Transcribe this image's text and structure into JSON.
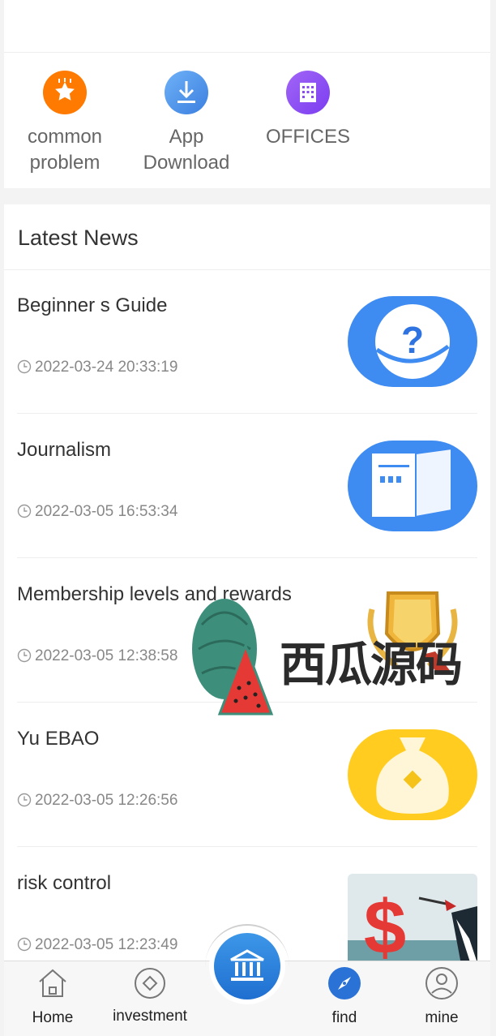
{
  "shortcuts": [
    {
      "label_line1": "common",
      "label_line2": "problem",
      "icon": "star-icon",
      "color": "#ff7a00"
    },
    {
      "label_line1": "App",
      "label_line2": "Download",
      "icon": "download-icon",
      "color": "#4b8fe8"
    },
    {
      "label_line1": "OFFICES",
      "label_line2": "",
      "icon": "building-icon",
      "color": "#8a4cf0"
    }
  ],
  "news": {
    "title": "Latest News",
    "items": [
      {
        "title": "Beginner s Guide",
        "date": "2022-03-24 20:33:19",
        "thumb": "question-icon"
      },
      {
        "title": "Journalism",
        "date": "2022-03-05 16:53:34",
        "thumb": "book-icon"
      },
      {
        "title": "Membership levels and rewards",
        "date": "2022-03-05 12:38:58",
        "thumb": "badge-icon"
      },
      {
        "title": "Yu EBAO",
        "date": "2022-03-05 12:26:56",
        "thumb": "money-bag-icon"
      },
      {
        "title": "risk control",
        "date": "2022-03-05 12:23:49",
        "thumb": "dollar-dart-icon"
      }
    ]
  },
  "watermark": {
    "text": "西瓜源码"
  },
  "tabs": {
    "home": "Home",
    "investment": "investment",
    "find": "find",
    "mine": "mine"
  }
}
